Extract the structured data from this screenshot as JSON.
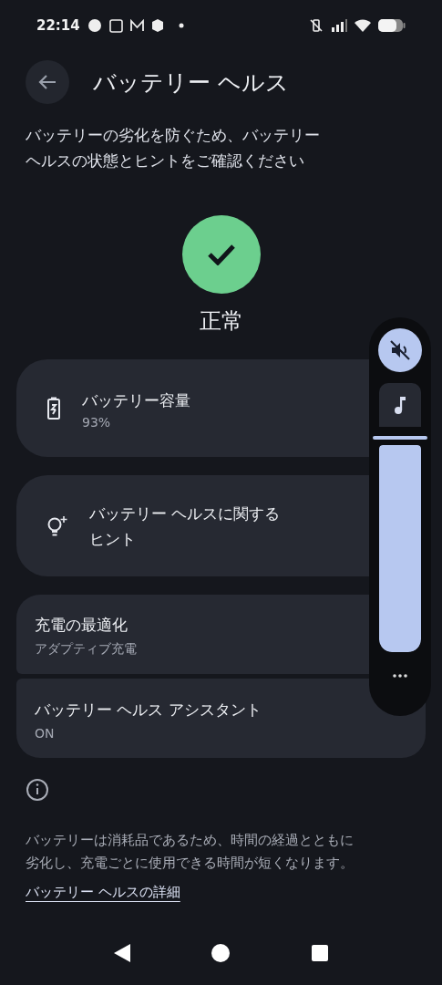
{
  "status_bar": {
    "time": "22:14"
  },
  "header": {
    "title": "バッテリー ヘルス"
  },
  "description": "バッテリーの劣化を防ぐため、バッテリーヘルスの状態とヒントをご確認ください",
  "health": {
    "label": "正常"
  },
  "cards": [
    {
      "kind": "battery",
      "title": "バッテリー容量",
      "subtitle": "93%"
    },
    {
      "kind": "tip",
      "title": "バッテリー ヘルスに関するヒント"
    }
  ],
  "settings": [
    {
      "title": "充電の最適化",
      "subtitle": "アダプティブ充電"
    },
    {
      "title": "バッテリー ヘルス アシスタント",
      "subtitle": "ON"
    }
  ],
  "info": {
    "text": "バッテリーは消耗品であるため、時間の経過とともに劣化し、充電ごとに使用できる時間が短くなります。",
    "link": "バッテリー ヘルスの詳細"
  },
  "volume_panel": {
    "muted": true,
    "level": 1
  }
}
